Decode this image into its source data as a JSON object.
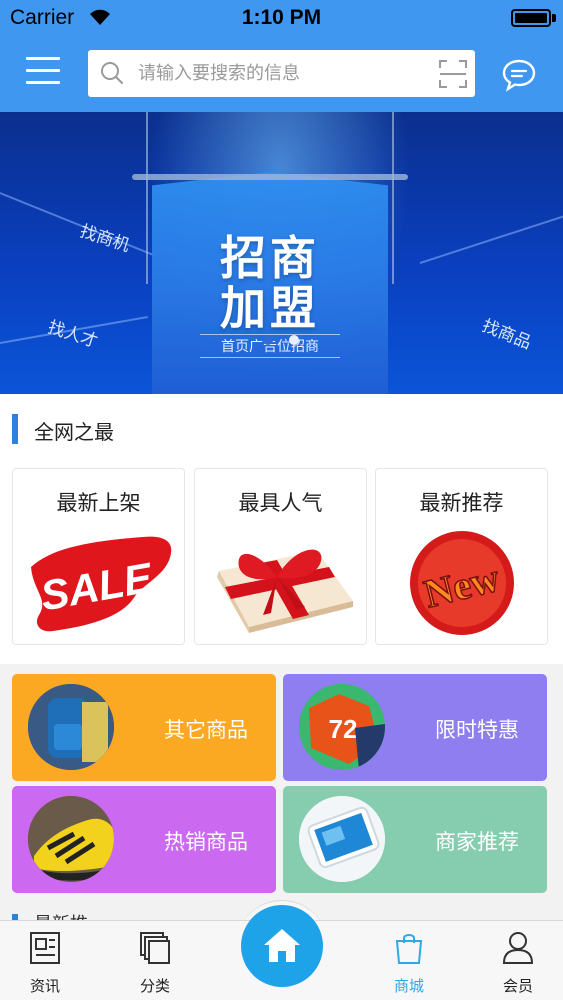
{
  "status_bar": {
    "carrier": "Carrier",
    "time": "1:10 PM"
  },
  "header": {
    "search_placeholder": "请输入要搜索的信息",
    "icons": [
      "menu-icon",
      "search-icon",
      "scan-icon",
      "message-icon"
    ],
    "background_color": "#3f97f0"
  },
  "banner": {
    "title_line1": "招商",
    "title_line2": "加盟",
    "subtitle": "首页广告位招商",
    "left_top_text": "找商机",
    "left_bottom_text": "找人才",
    "right_text": "找商品",
    "pagination": {
      "count": 2,
      "active_index": 0
    }
  },
  "section_best": {
    "title": "全网之最",
    "cards": [
      {
        "label": "最新上架",
        "image": "sale-brush-icon"
      },
      {
        "label": "最具人气",
        "image": "gift-box-icon"
      },
      {
        "label": "最新推荐",
        "image": "new-badge-icon"
      }
    ]
  },
  "categories": [
    {
      "label": "其它商品",
      "color": "#fba922",
      "image": "backpack-icon"
    },
    {
      "label": "限时特惠",
      "color": "#8e7ef0",
      "image": "jersey-icon"
    },
    {
      "label": "热销商品",
      "color": "#cb6af0",
      "image": "sneaker-icon"
    },
    {
      "label": "商家推荐",
      "color": "#86cdb0",
      "image": "phone-icon"
    }
  ],
  "next_section": {
    "title_peek": "最新推"
  },
  "tabbar": {
    "tabs": [
      {
        "label": "资讯",
        "icon": "news-icon"
      },
      {
        "label": "分类",
        "icon": "category-icon"
      },
      {
        "label": "",
        "icon": "home-icon"
      },
      {
        "label": "商城",
        "icon": "shopping-bag-icon",
        "active": true
      },
      {
        "label": "会员",
        "icon": "member-icon"
      }
    ],
    "active_color": "#2fa9e6",
    "home_color": "#1ea3e8"
  }
}
